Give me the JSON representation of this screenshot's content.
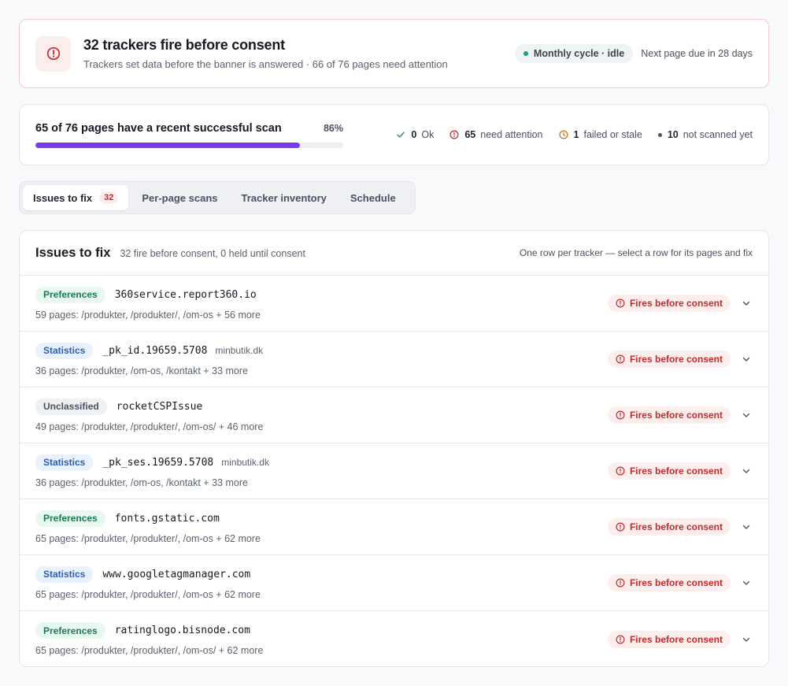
{
  "alert": {
    "icon": "alert-circle-icon",
    "title": "32 trackers fire before consent",
    "subtitle": "Trackers set data before the banner is answered · 66 of 76 pages need attention",
    "cycle_label": "Monthly cycle · idle",
    "due_text": "Next page due in 28 days",
    "accent_color": "#c42b2b"
  },
  "progress": {
    "title": "65 of 76 pages have a recent successful scan",
    "percent_label": "86%",
    "percent_value": 86,
    "bar_color": "#7c3aed",
    "stats": [
      {
        "icon": "check-icon",
        "count": "0",
        "label": "Ok"
      },
      {
        "icon": "alert-circle-icon",
        "count": "65",
        "label": "need attention"
      },
      {
        "icon": "clock-icon",
        "count": "1",
        "label": "failed or stale"
      },
      {
        "icon": "dot-icon",
        "count": "10",
        "label": "not scanned yet"
      }
    ]
  },
  "tabs": [
    {
      "label": "Issues to fix",
      "count": "32",
      "active": true
    },
    {
      "label": "Per-page scans",
      "active": false
    },
    {
      "label": "Tracker inventory",
      "active": false
    },
    {
      "label": "Schedule",
      "active": false
    }
  ],
  "issues": {
    "title": "Issues to fix",
    "subtitle": "32 fire before consent, 0 held until consent",
    "hint": "One row per tracker — select a row for its pages and fix",
    "status_label": "Fires before consent",
    "rows": [
      {
        "category": "Preferences",
        "name": "360service.report360.io",
        "domain": "",
        "pages": "59 pages: /produkter, /produkter/, /om-os + 56 more"
      },
      {
        "category": "Statistics",
        "name": "_pk_id.19659.5708",
        "domain": "minbutik.dk",
        "pages": "36 pages: /produkter, /om-os, /kontakt + 33 more"
      },
      {
        "category": "Unclassified",
        "name": "rocketCSPIssue",
        "domain": "",
        "pages": "49 pages: /produkter, /produkter/, /om-os/ + 46 more"
      },
      {
        "category": "Statistics",
        "name": "_pk_ses.19659.5708",
        "domain": "minbutik.dk",
        "pages": "36 pages: /produkter, /om-os, /kontakt + 33 more"
      },
      {
        "category": "Preferences",
        "name": "fonts.gstatic.com",
        "domain": "",
        "pages": "65 pages: /produkter, /produkter/, /om-os + 62 more"
      },
      {
        "category": "Statistics",
        "name": "www.googletagmanager.com",
        "domain": "",
        "pages": "65 pages: /produkter, /produkter/, /om-os + 62 more"
      },
      {
        "category": "Preferences",
        "name": "ratinglogo.bisnode.com",
        "domain": "",
        "pages": "65 pages: /produkter, /produkter/, /om-os/ + 62 more"
      }
    ]
  }
}
